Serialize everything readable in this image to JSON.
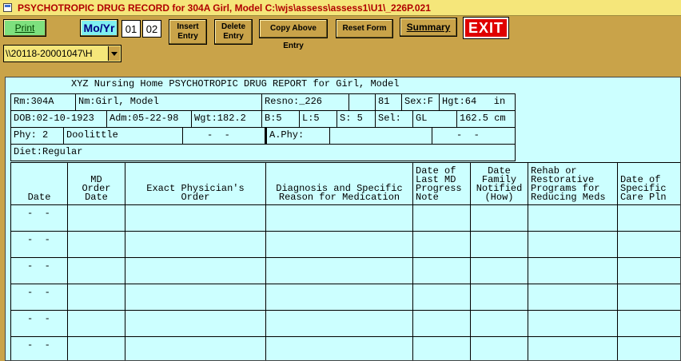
{
  "window": {
    "title": "PSYCHOTROPIC DRUG RECORD for 304A   Girl, Model  C:\\wjs\\assess\\assess1\\U1\\_226P.021"
  },
  "toolbar": {
    "print_label": "Print",
    "moyr_label": "Mo/Yr",
    "month_value": "01",
    "year_value": "02",
    "insert_line1": "Insert",
    "insert_line2": "Entry",
    "delete_line1": "Delete",
    "delete_line2": "Entry",
    "copy_label": "Copy Above Entry",
    "reset_label": "Reset Form",
    "summary_label": "Summary",
    "exit_label": "EXIT"
  },
  "selector": {
    "value": "\\\\20118-20001047\\H"
  },
  "form": {
    "title": "XYZ Nursing Home PSYCHOTROPIC DRUG REPORT for Girl, Model",
    "rm": "Rm:304A",
    "nm": "Nm:Girl, Model",
    "resno": "Resno:_226",
    "age": "81",
    "sex": "Sex:F",
    "hgt": "Hgt:64   in",
    "dob": "DOB:02-10-1923",
    "adm": "Adm:05-22-98",
    "wgt": "Wgt:182.2",
    "b": "B:5",
    "l": "L:5",
    "s": "S: 5",
    "sel": "Sel:",
    "gl": "GL",
    "weight_cm": "162.5 cm",
    "phy": "Phy: 2",
    "phy_name": "Doolittle",
    "phy_date": "-  -",
    "aphy": "A.Phy:",
    "aphy_date": "-  -",
    "diet": "Diet:Regular"
  },
  "table": {
    "headers": [
      "Date",
      "MD\nOrder\nDate",
      "Exact Physician's\nOrder",
      "Diagnosis and Specific\nReason for Medication",
      "Date of\nLast MD\nProgress\nNote",
      "Date\nFamily\nNotified\n(How)",
      "Rehab or\nRestorative\nPrograms for\nReducing Meds",
      "Date of\nSpecific\nCare Pln"
    ],
    "rows": [
      {
        "date": "-  -"
      },
      {
        "date": "-  -"
      },
      {
        "date": "-  -"
      },
      {
        "date": "-  -"
      },
      {
        "date": "-  -"
      },
      {
        "date": "-  -"
      }
    ]
  }
}
